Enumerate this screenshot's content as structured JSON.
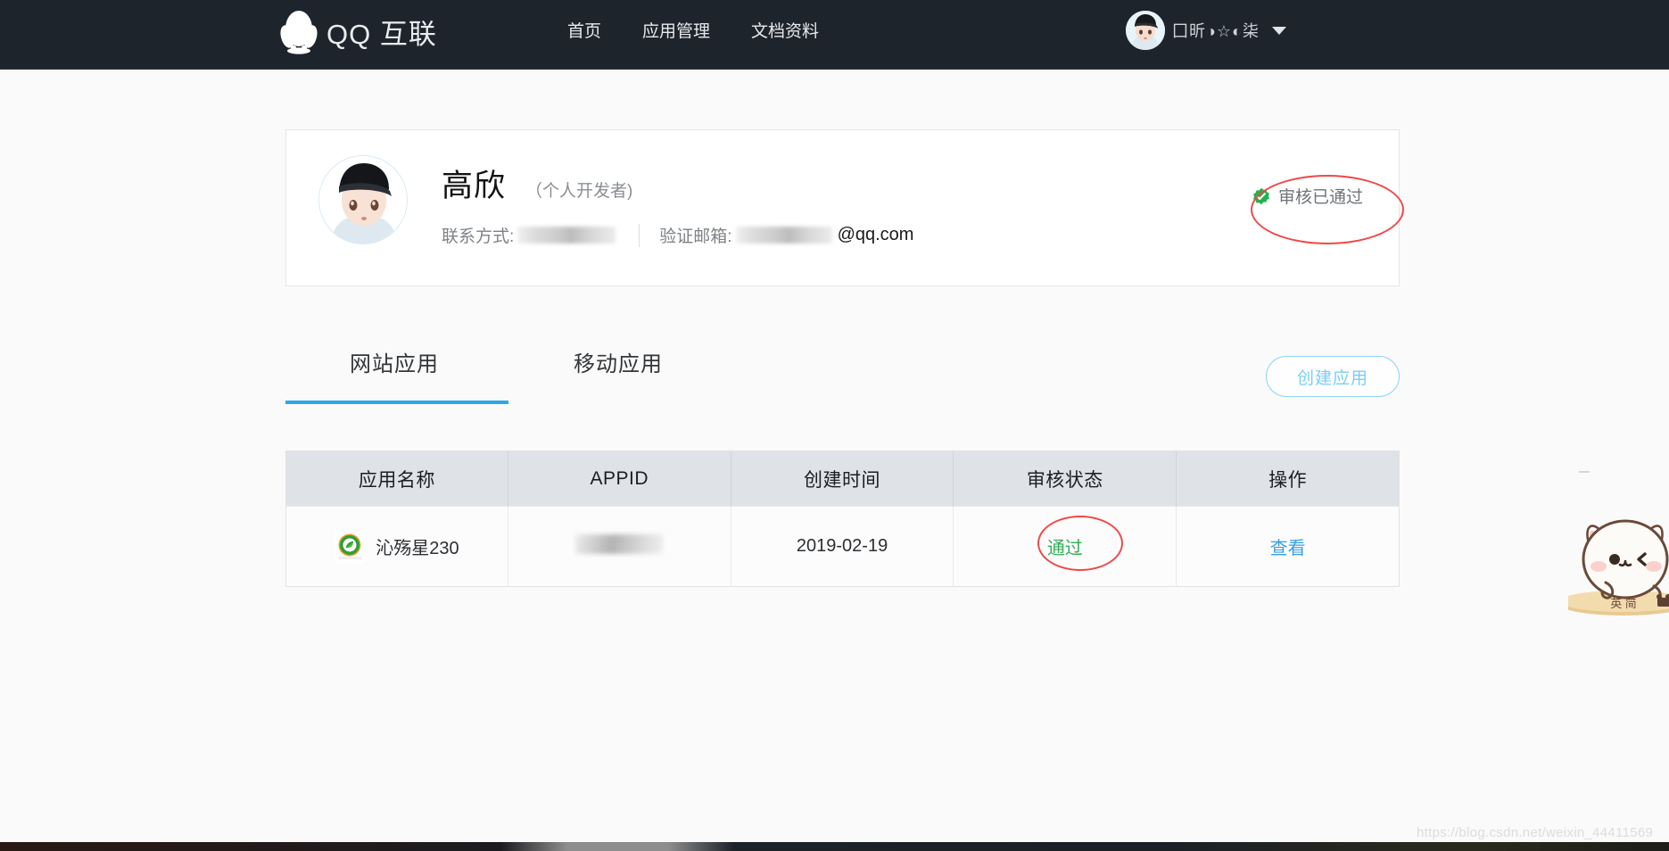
{
  "header": {
    "brand_text": "QQ 互联",
    "logo_icon": "qq-penguin-icon",
    "nav": [
      {
        "label": "首页"
      },
      {
        "label": "应用管理"
      },
      {
        "label": "文档资料"
      }
    ],
    "user": {
      "name": "囗昕◑☆◐柒",
      "avatar_icon": "user-avatar-anime-boy",
      "caret_icon": "chevron-down-icon"
    },
    "background_color": "#1e242b"
  },
  "profile": {
    "avatar_icon": "developer-avatar-anime-boy",
    "name": "高欣",
    "type": "（个人开发者)",
    "contact_label": "联系方式:",
    "contact_value": "",
    "email_label": "验证邮箱:",
    "email_value": "",
    "email_domain": "@qq.com",
    "status_text": "审核已通过",
    "status_icon": "verified-check-icon",
    "status_color": "#2fae55",
    "annotation_color": "#ed4a4a"
  },
  "tabs": [
    {
      "label": "网站应用",
      "active": true
    },
    {
      "label": "移动应用",
      "active": false
    }
  ],
  "actions": {
    "create_app_label": "创建应用",
    "create_app_color": "#7ccdf5"
  },
  "table": {
    "columns": [
      "应用名称",
      "APPID",
      "创建时间",
      "审核状态",
      "操作"
    ],
    "rows": [
      {
        "app_icon": "green-leaf-app-icon",
        "app_name": "沁殇星230",
        "appid": "",
        "created": "2019-02-19",
        "status": "通过",
        "status_color": "#2fae55",
        "action": "查看",
        "action_color": "#3a9fe0"
      }
    ]
  },
  "decorations": {
    "sticker_icon": "peach-cat-sticker",
    "sticker_text": "英 简",
    "watermark": "https://blog.csdn.net/weixin_44411569"
  }
}
